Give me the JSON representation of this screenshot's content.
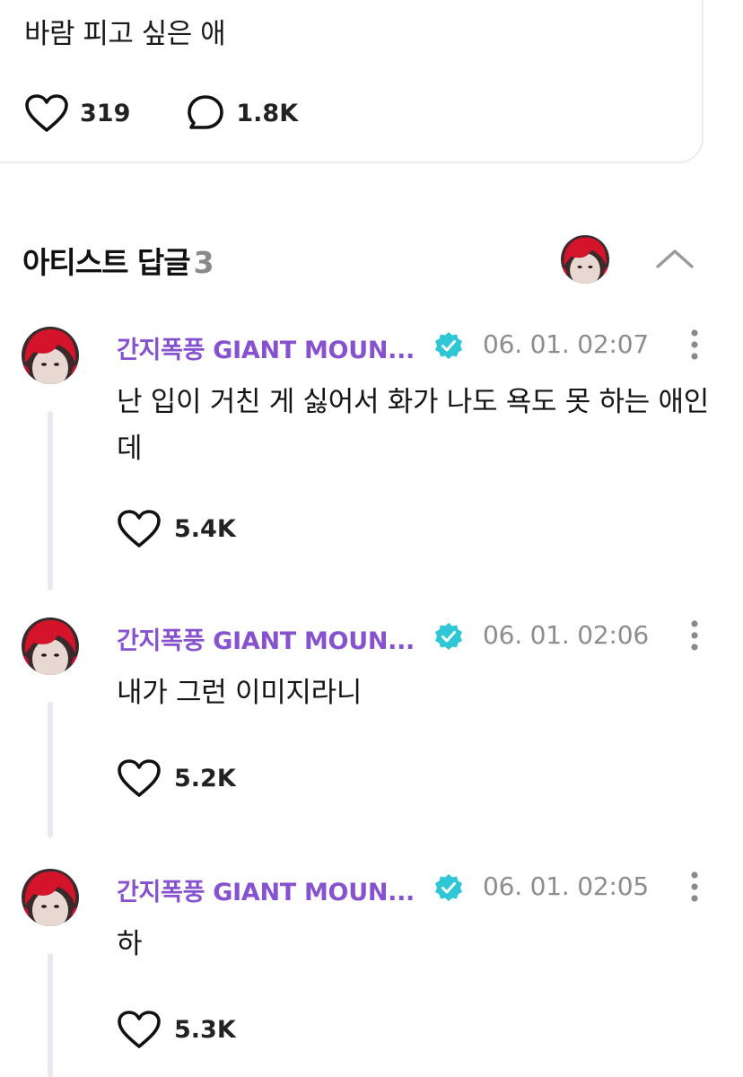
{
  "post": {
    "text": "바람 피고 싶은 애",
    "likes": "319",
    "replies": "1.8K"
  },
  "section": {
    "title": "아티스트 답글",
    "count": "3"
  },
  "comments": [
    {
      "author": "간지폭풍 GIANT MOUN...",
      "time": "06. 01. 02:07",
      "text": "난 입이 거친 게 싫어서 화가 나도 욕도 못 하는 애인데",
      "likes": "5.4K"
    },
    {
      "author": "간지폭풍 GIANT MOUN...",
      "time": "06. 01. 02:06",
      "text": "내가 그런 이미지라니",
      "likes": "5.2K"
    },
    {
      "author": "간지폭풍 GIANT MOUN...",
      "time": "06. 01. 02:05",
      "text": "하",
      "likes": "5.3K"
    }
  ],
  "colors": {
    "author": "#8652ce",
    "verified": "#2fc6d6",
    "meta": "#8d8d8d"
  },
  "icons": {
    "like": "heart-icon",
    "reply": "speech-bubble-icon",
    "collapse": "chevron-up-icon",
    "more": "more-vertical-icon",
    "verified": "verified-badge-icon"
  }
}
